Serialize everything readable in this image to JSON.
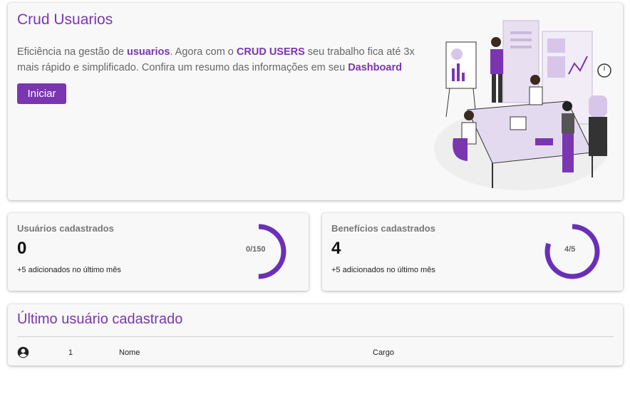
{
  "hero": {
    "title": "Crud Usuarios",
    "desc_1": "Eficiência na gestão de ",
    "desc_b1": "usuarios",
    "desc_2": ". Agora com o ",
    "desc_b2": "CRUD USERS",
    "desc_3": " seu trabalho fica até 3x mais rápido e simplificado. Confira um resumo das informações em seu ",
    "desc_b3": "Dashboard",
    "button_label": "Iniciar"
  },
  "stats": {
    "users": {
      "label": "Usuários cadastrados",
      "value": "0",
      "sub": "+5 adicionados no último mês",
      "ratio": "0/150",
      "progress": 0.5
    },
    "benefits": {
      "label": "Benefícios cadastrados",
      "value": "4",
      "sub": "+5 adicionados no último mês",
      "ratio": "4/5",
      "progress": 0.8
    }
  },
  "last_user": {
    "title": "Último usuário cadastrado",
    "id": "1",
    "name": "Nome",
    "role": "Cargo"
  },
  "colors": {
    "accent": "#7a35b0",
    "ring": "#6a2fb8"
  }
}
